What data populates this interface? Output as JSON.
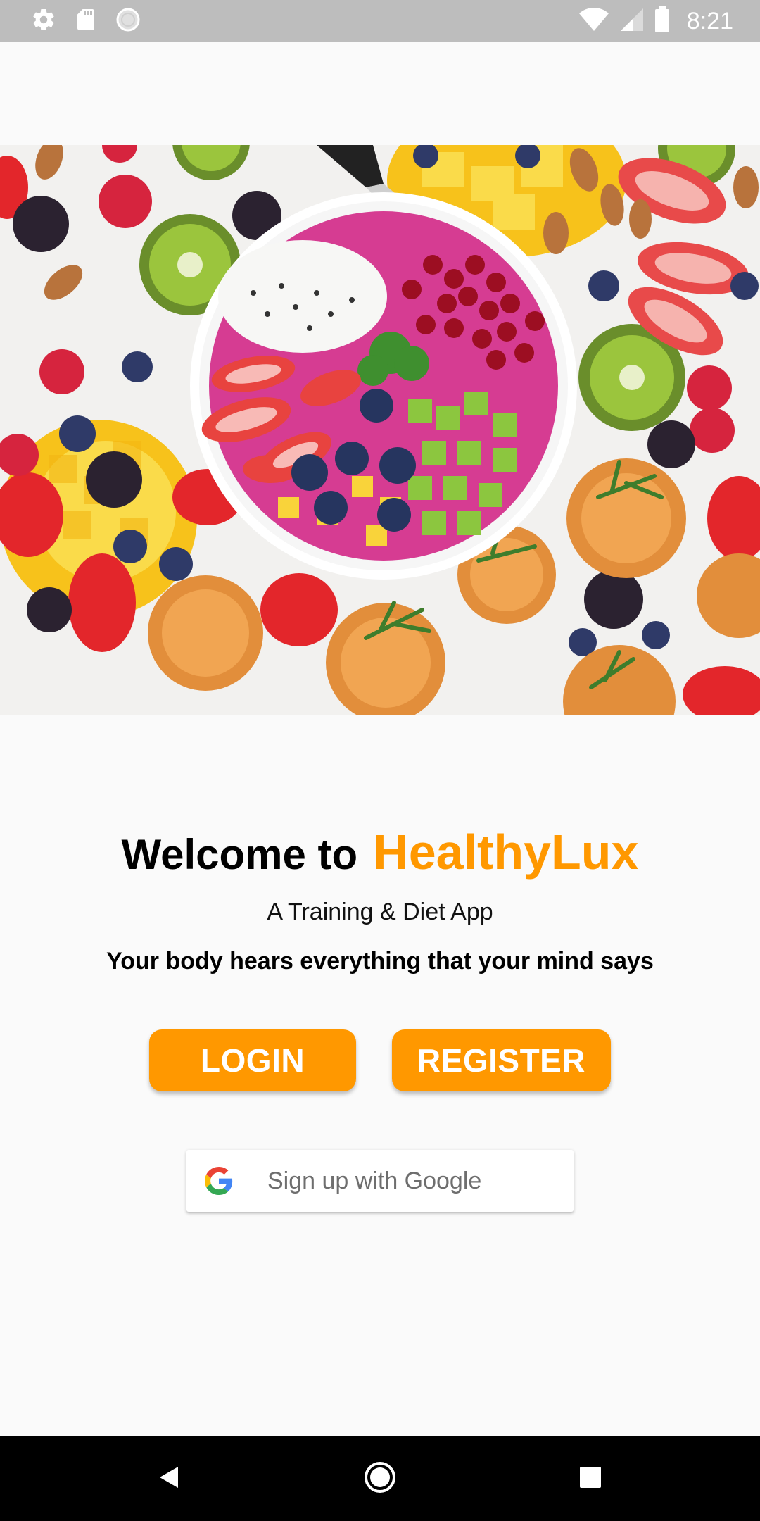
{
  "status_bar": {
    "time": "8:21",
    "icons_left": [
      "settings-icon",
      "sd-card-icon",
      "sync-circle-icon"
    ],
    "icons_right": [
      "wifi-icon",
      "cellular-signal-icon",
      "battery-icon"
    ]
  },
  "hero": {
    "image": "fruit-bowl-photo"
  },
  "welcome": {
    "prefix": "Welcome to",
    "brand": "HealthyLux",
    "subtitle": "A Training & Diet App",
    "tagline": "Your body hears everything that your mind says"
  },
  "actions": {
    "login_label": "LOGIN",
    "register_label": "REGISTER",
    "google_label": "Sign up with Google"
  },
  "nav_bar": {
    "buttons": [
      "back-icon",
      "home-icon",
      "recents-icon"
    ]
  },
  "colors": {
    "accent": "#FF9800",
    "status_bar": "#BDBDBD",
    "background": "#FAFAFA",
    "nav_bar": "#000000"
  }
}
